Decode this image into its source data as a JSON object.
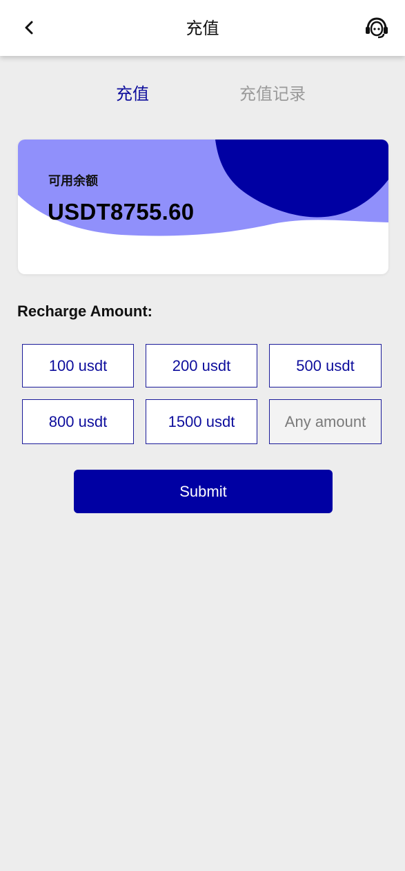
{
  "header": {
    "title": "充值",
    "back_icon": "chevron-left-icon",
    "support_icon": "customer-service-icon"
  },
  "tabs": [
    {
      "label": "充值",
      "active": true
    },
    {
      "label": "充值记录",
      "active": false
    }
  ],
  "balance_card": {
    "label": "可用余额",
    "value": "USDT8755.60",
    "colors": {
      "light_wave": "#9090fb",
      "dark_blob": "#0000a3"
    }
  },
  "recharge": {
    "heading": "Recharge Amount:",
    "options": [
      "100 usdt",
      "200 usdt",
      "500 usdt",
      "800 usdt",
      "1500 usdt"
    ],
    "custom_input": {
      "placeholder": "Any amount",
      "value": ""
    },
    "submit_label": "Submit"
  },
  "colors": {
    "accent": "#0000a3",
    "tab_active": "#0d0d9c",
    "tab_inactive": "#9a9a9a",
    "page_background": "#ededed"
  }
}
